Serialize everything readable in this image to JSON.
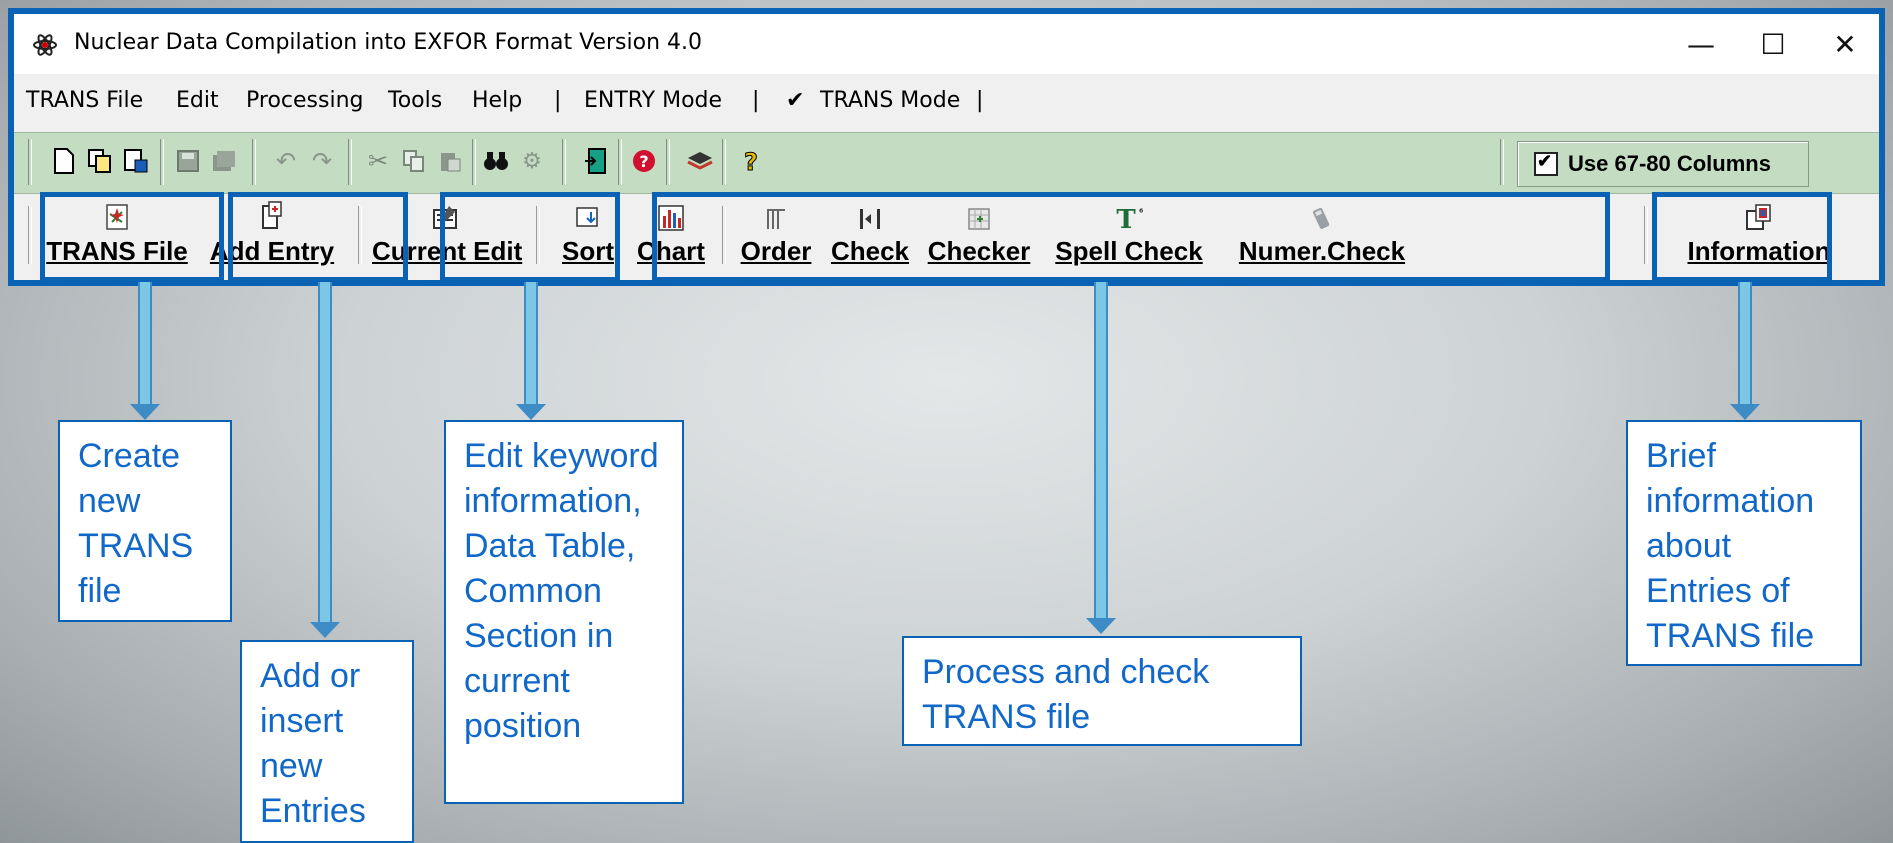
{
  "window": {
    "title": "Nuclear Data Compilation into EXFOR Format Version 4.0",
    "controls": [
      "—",
      "☐",
      "✕"
    ]
  },
  "menu": {
    "items": [
      "TRANS File",
      "Edit",
      "Processing",
      "Tools",
      "Help",
      "|",
      "ENTRY Mode",
      "|",
      "✔",
      "TRANS Mode",
      "|"
    ]
  },
  "toolbar": {
    "use_columns_label": "Use 67-80  Columns",
    "use_columns_checked": true
  },
  "actions": [
    {
      "label": "TRANS File",
      "icon": "trans-file-icon"
    },
    {
      "label": "Add Entry",
      "icon": "add-entry-icon"
    },
    {
      "label": "Current Edit",
      "icon": "current-edit-icon"
    },
    {
      "label": "Sort",
      "icon": "sort-icon"
    },
    {
      "label": "Chart",
      "icon": "chart-icon"
    },
    {
      "label": "Order",
      "icon": "order-icon"
    },
    {
      "label": "Check",
      "icon": "check-icon"
    },
    {
      "label": "Checker",
      "icon": "checker-icon"
    },
    {
      "label": "Spell Check",
      "icon": "spell-check-icon"
    },
    {
      "label": "Numer.Check",
      "icon": "numer-check-icon"
    },
    {
      "label": "Information",
      "icon": "information-icon"
    }
  ],
  "callouts": {
    "create": "Create new TRANS file",
    "add": "Add or insert new Entries",
    "edit": "Edit keyword information, Data Table, Common Section in current position",
    "process": "Process and check TRANS file",
    "info": "Brief information about Entries of TRANS file"
  },
  "colors": {
    "highlight": "#0a62b5",
    "callout_text": "#1168c8",
    "toolbar_bg": "#c3dcc2",
    "arrow_fill": "#7cc6e6"
  }
}
